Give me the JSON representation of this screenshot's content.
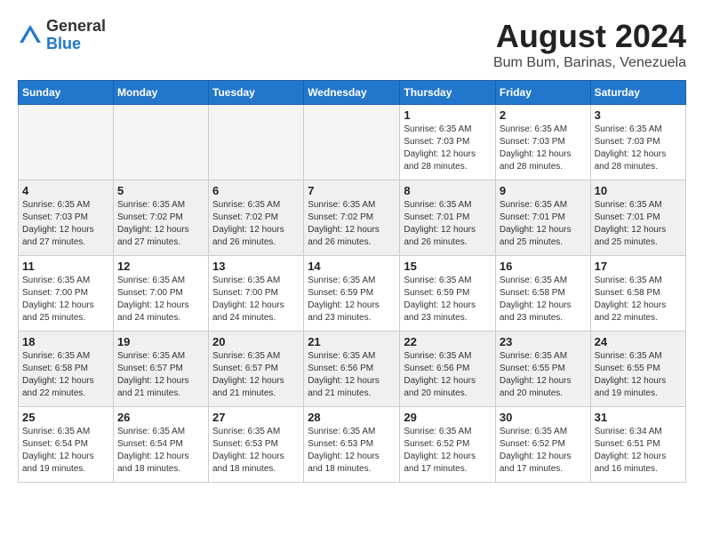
{
  "header": {
    "logo_general": "General",
    "logo_blue": "Blue",
    "month_title": "August 2024",
    "subtitle": "Bum Bum, Barinas, Venezuela"
  },
  "days_of_week": [
    "Sunday",
    "Monday",
    "Tuesday",
    "Wednesday",
    "Thursday",
    "Friday",
    "Saturday"
  ],
  "weeks": [
    [
      {
        "day": "",
        "info": ""
      },
      {
        "day": "",
        "info": ""
      },
      {
        "day": "",
        "info": ""
      },
      {
        "day": "",
        "info": ""
      },
      {
        "day": "1",
        "info": "Sunrise: 6:35 AM\nSunset: 7:03 PM\nDaylight: 12 hours\nand 28 minutes."
      },
      {
        "day": "2",
        "info": "Sunrise: 6:35 AM\nSunset: 7:03 PM\nDaylight: 12 hours\nand 28 minutes."
      },
      {
        "day": "3",
        "info": "Sunrise: 6:35 AM\nSunset: 7:03 PM\nDaylight: 12 hours\nand 28 minutes."
      }
    ],
    [
      {
        "day": "4",
        "info": "Sunrise: 6:35 AM\nSunset: 7:03 PM\nDaylight: 12 hours\nand 27 minutes."
      },
      {
        "day": "5",
        "info": "Sunrise: 6:35 AM\nSunset: 7:02 PM\nDaylight: 12 hours\nand 27 minutes."
      },
      {
        "day": "6",
        "info": "Sunrise: 6:35 AM\nSunset: 7:02 PM\nDaylight: 12 hours\nand 26 minutes."
      },
      {
        "day": "7",
        "info": "Sunrise: 6:35 AM\nSunset: 7:02 PM\nDaylight: 12 hours\nand 26 minutes."
      },
      {
        "day": "8",
        "info": "Sunrise: 6:35 AM\nSunset: 7:01 PM\nDaylight: 12 hours\nand 26 minutes."
      },
      {
        "day": "9",
        "info": "Sunrise: 6:35 AM\nSunset: 7:01 PM\nDaylight: 12 hours\nand 25 minutes."
      },
      {
        "day": "10",
        "info": "Sunrise: 6:35 AM\nSunset: 7:01 PM\nDaylight: 12 hours\nand 25 minutes."
      }
    ],
    [
      {
        "day": "11",
        "info": "Sunrise: 6:35 AM\nSunset: 7:00 PM\nDaylight: 12 hours\nand 25 minutes."
      },
      {
        "day": "12",
        "info": "Sunrise: 6:35 AM\nSunset: 7:00 PM\nDaylight: 12 hours\nand 24 minutes."
      },
      {
        "day": "13",
        "info": "Sunrise: 6:35 AM\nSunset: 7:00 PM\nDaylight: 12 hours\nand 24 minutes."
      },
      {
        "day": "14",
        "info": "Sunrise: 6:35 AM\nSunset: 6:59 PM\nDaylight: 12 hours\nand 23 minutes."
      },
      {
        "day": "15",
        "info": "Sunrise: 6:35 AM\nSunset: 6:59 PM\nDaylight: 12 hours\nand 23 minutes."
      },
      {
        "day": "16",
        "info": "Sunrise: 6:35 AM\nSunset: 6:58 PM\nDaylight: 12 hours\nand 23 minutes."
      },
      {
        "day": "17",
        "info": "Sunrise: 6:35 AM\nSunset: 6:58 PM\nDaylight: 12 hours\nand 22 minutes."
      }
    ],
    [
      {
        "day": "18",
        "info": "Sunrise: 6:35 AM\nSunset: 6:58 PM\nDaylight: 12 hours\nand 22 minutes."
      },
      {
        "day": "19",
        "info": "Sunrise: 6:35 AM\nSunset: 6:57 PM\nDaylight: 12 hours\nand 21 minutes."
      },
      {
        "day": "20",
        "info": "Sunrise: 6:35 AM\nSunset: 6:57 PM\nDaylight: 12 hours\nand 21 minutes."
      },
      {
        "day": "21",
        "info": "Sunrise: 6:35 AM\nSunset: 6:56 PM\nDaylight: 12 hours\nand 21 minutes."
      },
      {
        "day": "22",
        "info": "Sunrise: 6:35 AM\nSunset: 6:56 PM\nDaylight: 12 hours\nand 20 minutes."
      },
      {
        "day": "23",
        "info": "Sunrise: 6:35 AM\nSunset: 6:55 PM\nDaylight: 12 hours\nand 20 minutes."
      },
      {
        "day": "24",
        "info": "Sunrise: 6:35 AM\nSunset: 6:55 PM\nDaylight: 12 hours\nand 19 minutes."
      }
    ],
    [
      {
        "day": "25",
        "info": "Sunrise: 6:35 AM\nSunset: 6:54 PM\nDaylight: 12 hours\nand 19 minutes."
      },
      {
        "day": "26",
        "info": "Sunrise: 6:35 AM\nSunset: 6:54 PM\nDaylight: 12 hours\nand 18 minutes."
      },
      {
        "day": "27",
        "info": "Sunrise: 6:35 AM\nSunset: 6:53 PM\nDaylight: 12 hours\nand 18 minutes."
      },
      {
        "day": "28",
        "info": "Sunrise: 6:35 AM\nSunset: 6:53 PM\nDaylight: 12 hours\nand 18 minutes."
      },
      {
        "day": "29",
        "info": "Sunrise: 6:35 AM\nSunset: 6:52 PM\nDaylight: 12 hours\nand 17 minutes."
      },
      {
        "day": "30",
        "info": "Sunrise: 6:35 AM\nSunset: 6:52 PM\nDaylight: 12 hours\nand 17 minutes."
      },
      {
        "day": "31",
        "info": "Sunrise: 6:34 AM\nSunset: 6:51 PM\nDaylight: 12 hours\nand 16 minutes."
      }
    ]
  ]
}
